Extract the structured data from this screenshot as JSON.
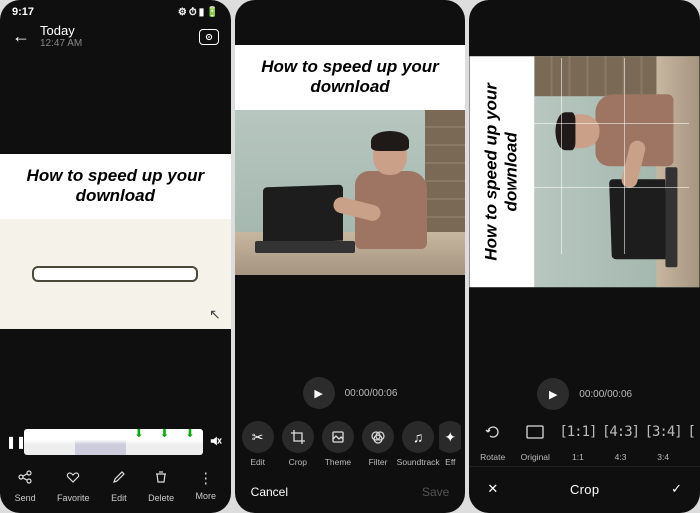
{
  "screen1": {
    "status": {
      "time": "9:17",
      "left_icons": "✉ ●",
      "right_icons": "⚙ ⏱ 📶 🔋",
      "battery_pct": "50"
    },
    "header": {
      "title": "Today",
      "subtitle": "12:47 AM"
    },
    "media_title": "How to speed up your download",
    "playpause": "❚❚",
    "mute": "🔇",
    "actions": [
      {
        "icon": "share",
        "label": "Send"
      },
      {
        "icon": "heart",
        "label": "Favorite"
      },
      {
        "icon": "pencil",
        "label": "Edit"
      },
      {
        "icon": "trash",
        "label": "Delete"
      },
      {
        "icon": "more",
        "label": "More"
      }
    ]
  },
  "screen2": {
    "media_title": "How to speed up your download",
    "time": "00:00/00:06",
    "tools": [
      {
        "icon": "scissors",
        "label": "Edit"
      },
      {
        "icon": "crop",
        "label": "Crop"
      },
      {
        "icon": "theme",
        "label": "Theme"
      },
      {
        "icon": "filter",
        "label": "Filter"
      },
      {
        "icon": "music",
        "label": "Soundtrack"
      },
      {
        "icon": "fx",
        "label": "Eff"
      }
    ],
    "cancel": "Cancel",
    "save": "Save"
  },
  "screen3": {
    "media_title": "How to speed up your download",
    "time": "00:00/00:06",
    "tools": [
      {
        "icon": "rotate",
        "label": "Rotate"
      },
      {
        "icon": "original",
        "label": "Original"
      },
      {
        "icon": "1:1",
        "label": "1:1"
      },
      {
        "icon": "4:3",
        "label": "4:3"
      },
      {
        "icon": "3:4",
        "label": "3:4"
      },
      {
        "icon": "more",
        "label": ""
      }
    ],
    "close": "✕",
    "title": "Crop",
    "confirm": "✓"
  }
}
